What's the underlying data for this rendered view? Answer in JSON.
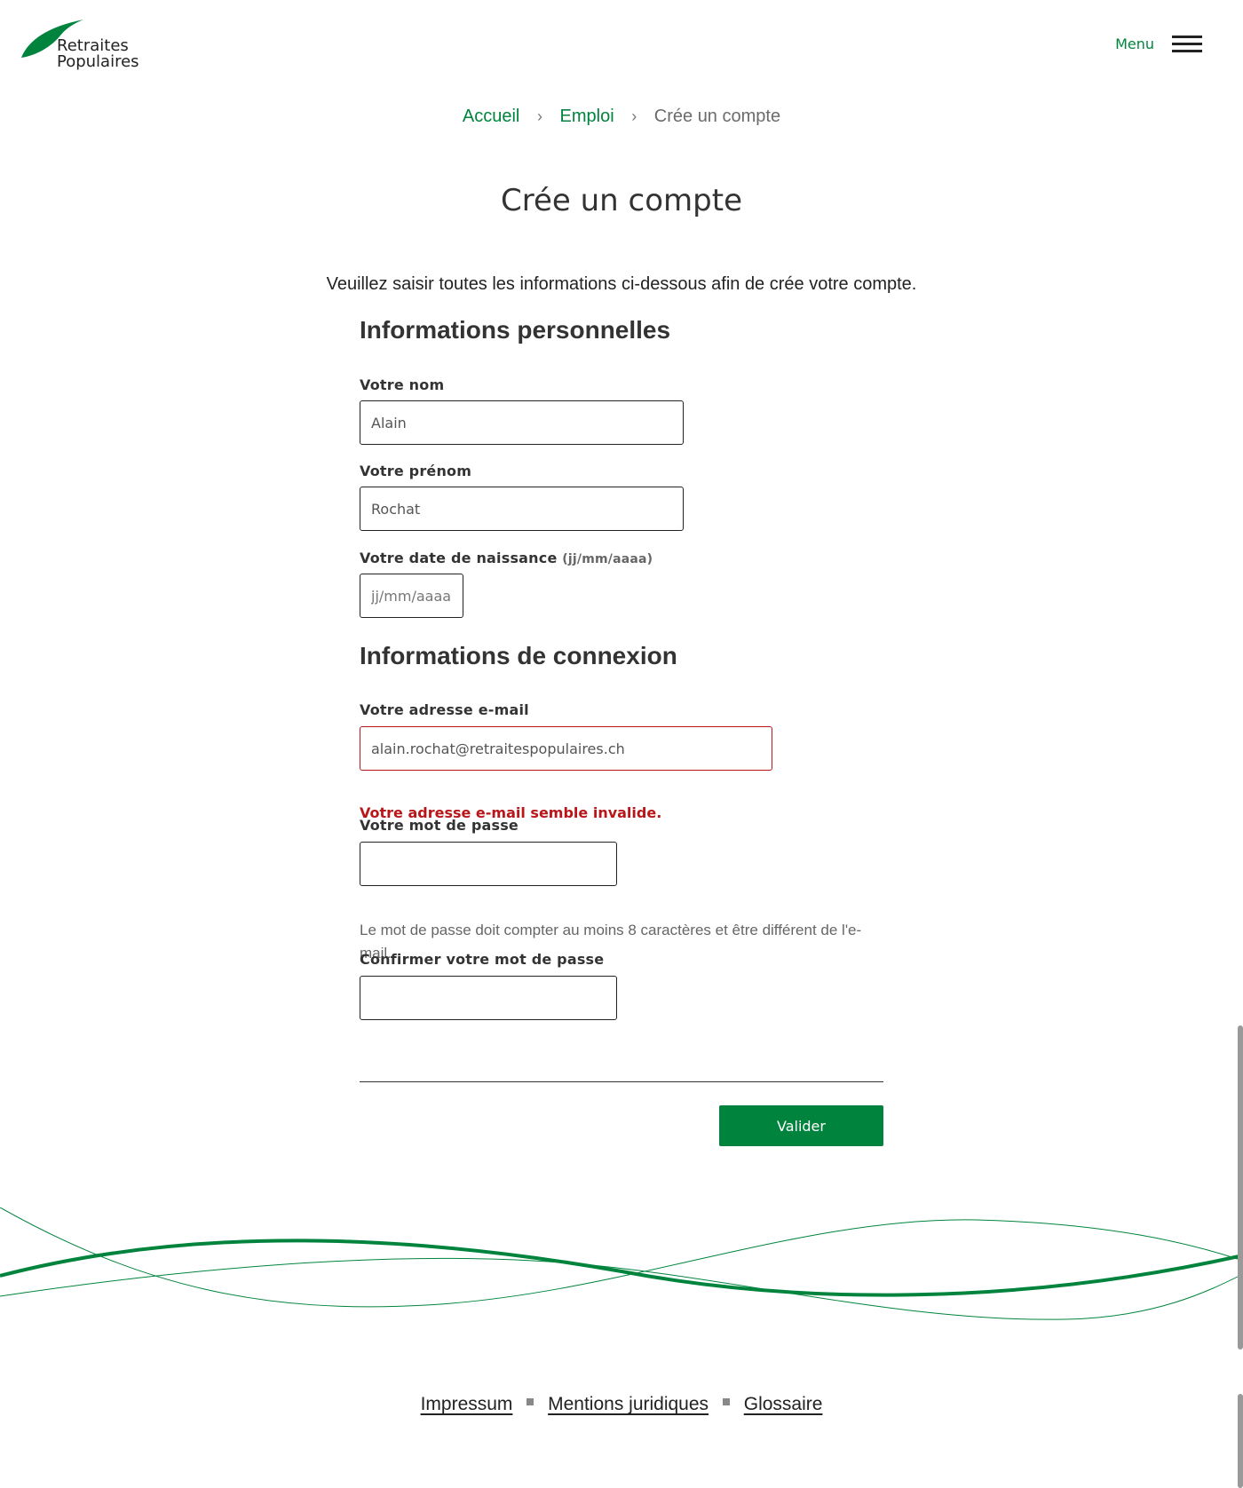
{
  "header": {
    "logo_line1": "Retraites",
    "logo_line2": "Populaires",
    "menu_label": "Menu",
    "brand_color": "#00843d"
  },
  "breadcrumb": {
    "items": [
      "Accueil",
      "Emploi"
    ],
    "separator": "›",
    "current": "Crée un compte"
  },
  "page": {
    "title": "Crée un compte",
    "intro": "Veuillez saisir toutes les informations ci-dessous afin de crée votre compte."
  },
  "personal": {
    "title": "Informations personnelles",
    "name_label": "Votre nom",
    "name_value": "Alain",
    "firstname_label": "Votre prénom",
    "firstname_value": "Rochat",
    "birth_label": "Votre date de naissance",
    "birth_hint": "(jj/mm/aaaa)",
    "birth_placeholder": "jj/mm/aaaa"
  },
  "login": {
    "title": "Informations de connexion",
    "email_label": "Votre adresse e-mail",
    "email_value": "alain.rochat@retraitespopulaires.ch",
    "email_error": "Votre adresse e-mail semble invalide.",
    "password_label": "Votre mot de passe",
    "password_help": "Le mot de passe doit compter au moins 8 caractères et être différent de l'e-mail.",
    "confirm_label": "Confirmer votre mot de passe"
  },
  "actions": {
    "validate_label": "Valider"
  },
  "footer": {
    "links": [
      "Impressum",
      "Mentions juridiques",
      "Glossaire"
    ]
  },
  "colors": {
    "accent": "#00843d",
    "error": "#b9161a"
  }
}
